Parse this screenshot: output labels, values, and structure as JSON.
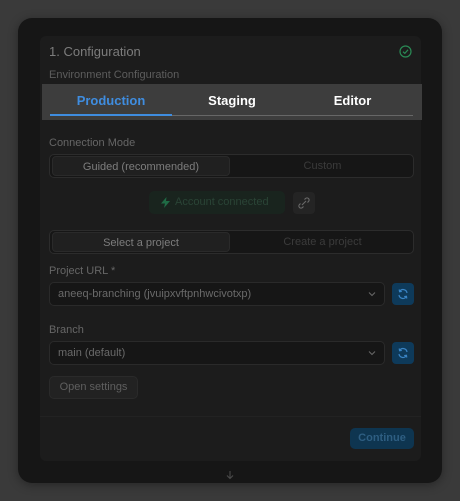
{
  "section": {
    "title": "1. Configuration",
    "env_label": "Environment Configuration"
  },
  "tabs": [
    {
      "label": "Production",
      "active": true
    },
    {
      "label": "Staging",
      "active": false
    },
    {
      "label": "Editor",
      "active": false
    }
  ],
  "connection": {
    "label": "Connection Mode",
    "options": [
      "Guided (recommended)",
      "Custom"
    ],
    "selected": "Guided (recommended)"
  },
  "account": {
    "button_label": "Account connected"
  },
  "project_mode": {
    "options": [
      "Select a project",
      "Create a project"
    ],
    "selected": "Select a project"
  },
  "project_url": {
    "label": "Project URL *",
    "value": "aneeq-branching (jvuipxvftpnhwcivotxp)"
  },
  "branch": {
    "label": "Branch",
    "value": "main (default)"
  },
  "open_settings_label": "Open settings",
  "continue_label": "Continue",
  "colors": {
    "accent": "#3f8de0",
    "success": "#2a8a55",
    "panel": "#1c1c1c",
    "tabbar": "#3d3d3d"
  }
}
